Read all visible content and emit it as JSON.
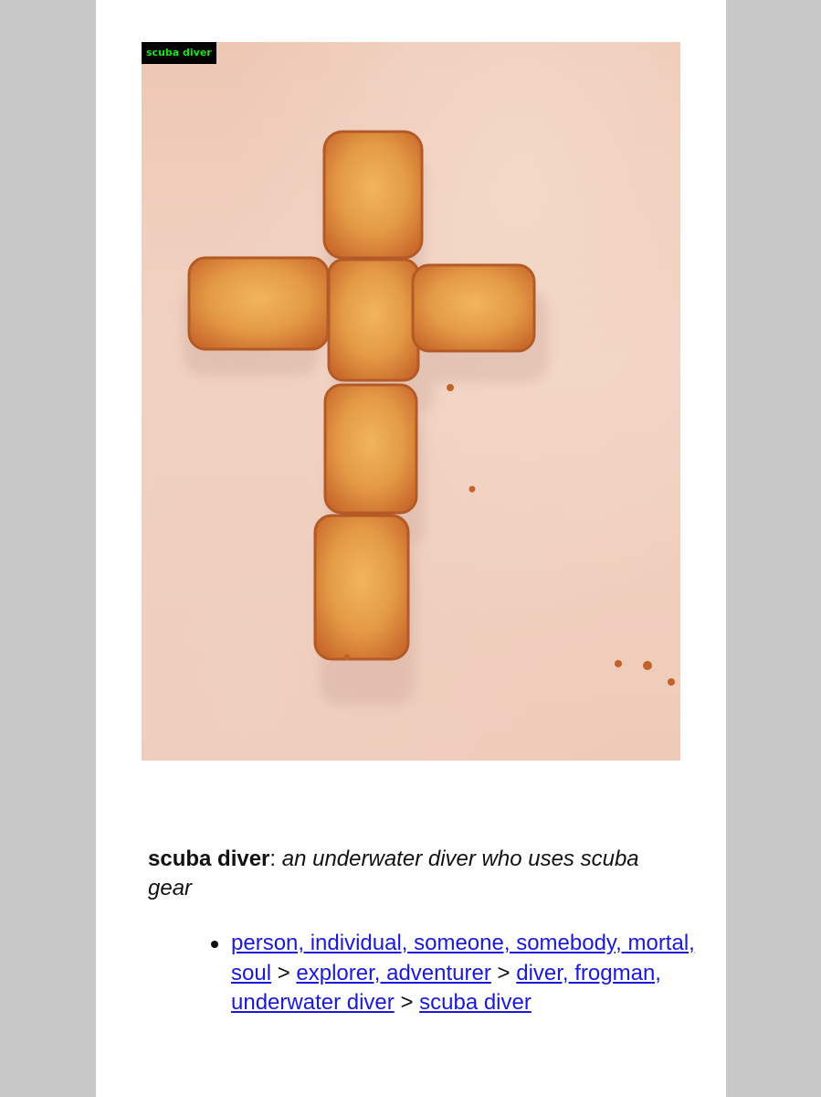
{
  "image": {
    "label_tag": "scuba diver"
  },
  "definition": {
    "term": "scuba diver",
    "separator": ":",
    "gloss": "an underwater diver who uses scuba gear"
  },
  "hypernym_chain": {
    "links": [
      "person, individual, someone, somebody, mortal, soul",
      "explorer, adventurer",
      "diver, frogman, underwater diver",
      "scuba diver"
    ],
    "separator": ">"
  },
  "colors": {
    "background": "#c8c8c8",
    "panel": "#ffffff",
    "link": "#1a1ad6",
    "tag_bg": "#000000",
    "tag_text": "#17e617"
  }
}
